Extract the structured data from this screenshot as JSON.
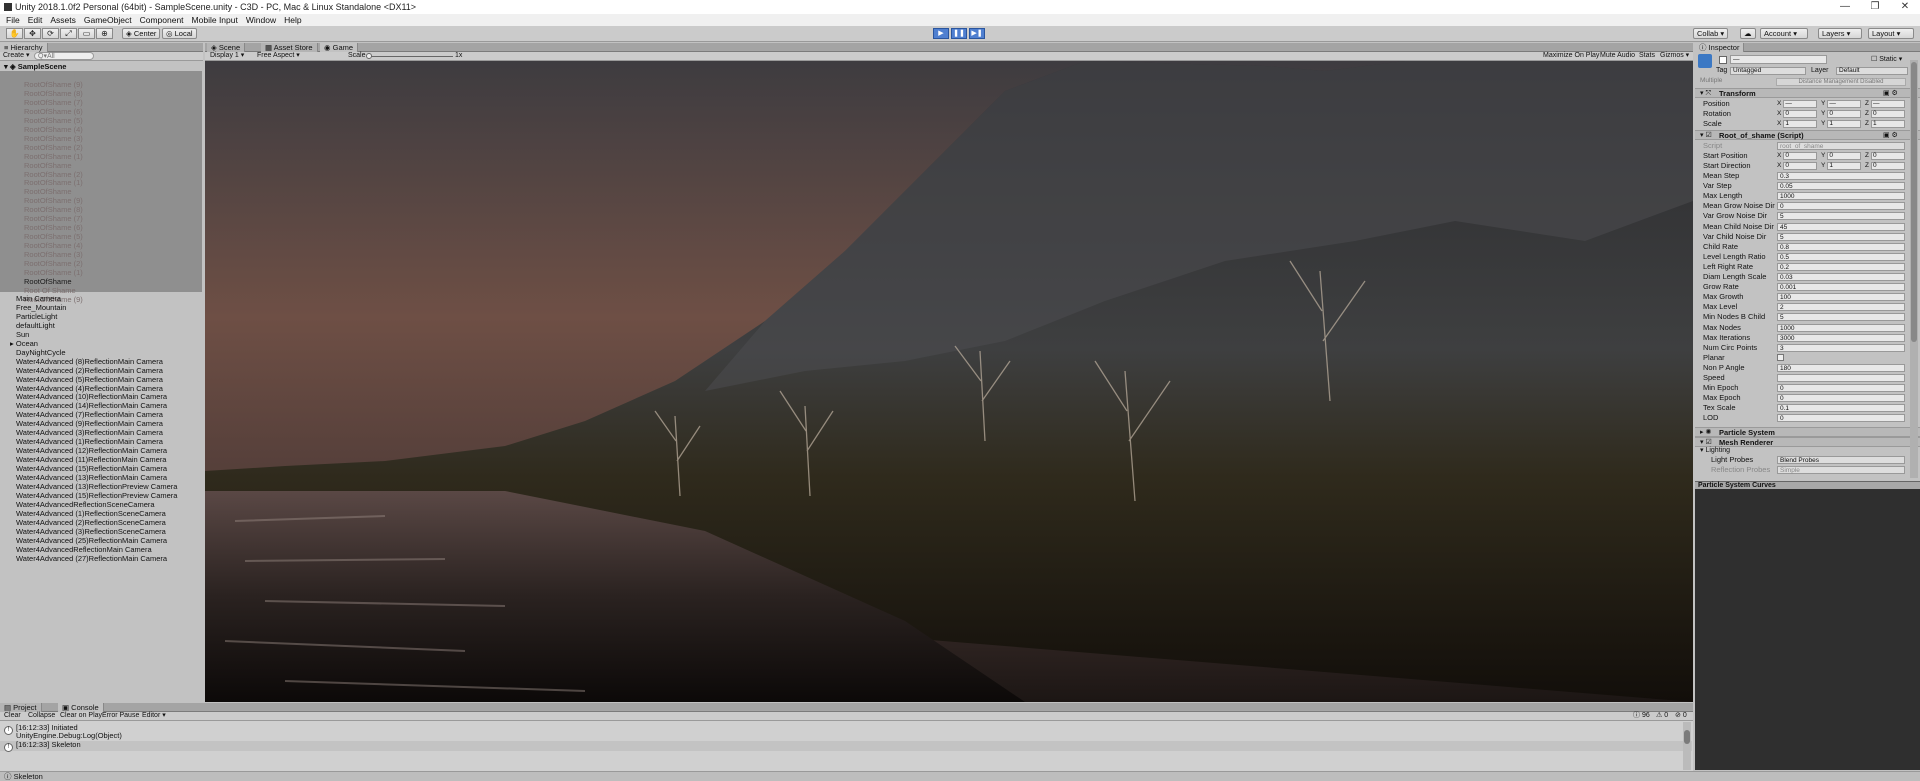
{
  "window": {
    "title": "Unity 2018.1.0f2 Personal (64bit) - SampleScene.unity - C3D - PC, Mac & Linux Standalone <DX11>",
    "controls": [
      "—",
      "❐",
      "✕"
    ]
  },
  "menu": [
    "File",
    "Edit",
    "Assets",
    "GameObject",
    "Component",
    "Mobile Input",
    "Window",
    "Help"
  ],
  "toolbar": {
    "pivot": "Center",
    "space": "Local",
    "collab": "Collab ▾",
    "account": "Account",
    "layers": "Layers",
    "layout": "Layout"
  },
  "hierarchy": {
    "tab": "Hierarchy",
    "create": "Create ▾",
    "search_placeholder": "Q▾All",
    "scene": "SampleScene",
    "group": "trees",
    "dim_items": [
      "RootOfShame (9)",
      "RootOfShame (8)",
      "RootOfShame (7)",
      "RootOfShame (6)",
      "RootOfShame (5)",
      "RootOfShame (4)",
      "RootOfShame (3)",
      "RootOfShame (2)",
      "RootOfShame (1)",
      "RootOfShame",
      "RootOfShame (2)",
      "RootOfShame (1)",
      "RootOfShame",
      "RootOfShame (9)",
      "RootOfShame (8)",
      "RootOfShame (7)",
      "RootOfShame (6)",
      "RootOfShame (5)",
      "RootOfShame (4)",
      "RootOfShame (3)",
      "RootOfShame (2)",
      "RootOfShame (1)"
    ],
    "highlight_item": "RootOfShame",
    "dim_tail": [
      "Root Of Shame",
      "RootOfShame (9)"
    ],
    "items": [
      "Main Camera",
      "Free_Mountain",
      "ParticleLight",
      "defaultLight",
      "Sun",
      "Ocean",
      "DayNightCycle",
      "Water4Advanced (8)ReflectionMain Camera",
      "Water4Advanced (2)ReflectionMain Camera",
      "Water4Advanced (5)ReflectionMain Camera",
      "Water4Advanced (4)ReflectionMain Camera",
      "Water4Advanced (10)ReflectionMain Camera",
      "Water4Advanced (14)ReflectionMain Camera",
      "Water4Advanced (7)ReflectionMain Camera",
      "Water4Advanced (9)ReflectionMain Camera",
      "Water4Advanced (3)ReflectionMain Camera",
      "Water4Advanced (1)ReflectionMain Camera",
      "Water4Advanced (12)ReflectionMain Camera",
      "Water4Advanced (11)ReflectionMain Camera",
      "Water4Advanced (15)ReflectionMain Camera",
      "Water4Advanced (13)ReflectionMain Camera",
      "Water4Advanced (13)ReflectionPreview Camera",
      "Water4Advanced (15)ReflectionPreview Camera",
      "Water4AdvancedReflectionSceneCamera",
      "Water4Advanced (1)ReflectionSceneCamera",
      "Water4Advanced (2)ReflectionSceneCamera",
      "Water4Advanced (3)ReflectionSceneCamera",
      "Water4Advanced (25)ReflectionMain Camera",
      "Water4AdvancedReflectionMain Camera",
      "Water4Advanced (27)ReflectionMain Camera"
    ]
  },
  "center": {
    "tabs": [
      "Scene",
      "Asset Store",
      "Game"
    ],
    "display": "Display 1",
    "aspect": "Free Aspect",
    "scale_label": "Scale",
    "scale_value": "1x",
    "options": [
      "Maximize On Play",
      "Mute Audio",
      "Stats",
      "Gizmos ▾"
    ]
  },
  "inspector": {
    "tab": "Inspector",
    "static_label": "Static",
    "tag_label": "Tag",
    "tag_value": "Untagged",
    "layer_label": "Layer",
    "layer_value": "Default",
    "multiple": "Multiple",
    "distance": "Distance Management Disabled",
    "transform": {
      "title": "Transform",
      "rows": [
        {
          "label": "Position",
          "x": "—",
          "y": "—",
          "z": "—"
        },
        {
          "label": "Rotation",
          "x": "0",
          "y": "0",
          "z": "0"
        },
        {
          "label": "Scale",
          "x": "1",
          "y": "1",
          "z": "1"
        }
      ]
    },
    "script_component": {
      "title": "Root_of_shame (Script)",
      "script_label": "Script",
      "script_value": "root_of_shame",
      "vectors": [
        {
          "label": "Start Position",
          "x": "0",
          "y": "0",
          "z": "0"
        },
        {
          "label": "Start Direction",
          "x": "0",
          "y": "1",
          "z": "0"
        }
      ],
      "fields": [
        {
          "label": "Mean Step",
          "value": "0.3"
        },
        {
          "label": "Var Step",
          "value": "0.05"
        },
        {
          "label": "Max Length",
          "value": "1000"
        },
        {
          "label": "Mean Grow Noise Dir",
          "value": "0"
        },
        {
          "label": "Var Grow Noise Dir",
          "value": "5"
        },
        {
          "label": "Mean Child Noise Dir",
          "value": "45"
        },
        {
          "label": "Var Child Noise Dir",
          "value": "5"
        },
        {
          "label": "Child Rate",
          "value": "0.8"
        },
        {
          "label": "Level Length Ratio",
          "value": "0.5"
        },
        {
          "label": "Left Right Rate",
          "value": "0.2"
        },
        {
          "label": "Diam Length Scale",
          "value": "0.03"
        },
        {
          "label": "Grow Rate",
          "value": "0.001"
        },
        {
          "label": "Max Growth",
          "value": "100"
        },
        {
          "label": "Max Level",
          "value": "2"
        },
        {
          "label": "Min Nodes B Child",
          "value": "5"
        },
        {
          "label": "Max Nodes",
          "value": "1000"
        },
        {
          "label": "Max Iterations",
          "value": "3000"
        },
        {
          "label": "Num Circ Points",
          "value": "3"
        },
        {
          "label": "Planar",
          "value": ""
        },
        {
          "label": "Non P Angle",
          "value": "180"
        },
        {
          "label": "Speed",
          "value": ""
        },
        {
          "label": "Min Epoch",
          "value": "0"
        },
        {
          "label": "Max Epoch",
          "value": "0"
        },
        {
          "label": "Tex Scale",
          "value": "0.1"
        },
        {
          "label": "LOD",
          "value": "0"
        }
      ]
    },
    "particle_system": "Particle System",
    "mesh_renderer": "Mesh Renderer",
    "lighting": "Lighting",
    "light_probes_label": "Light Probes",
    "light_probes_value": "Blend Probes",
    "reflection_label": "Reflection Probes",
    "reflection_value": "Simple",
    "curves_title": "Particle System Curves"
  },
  "bottom": {
    "tabs": [
      "Project",
      "Console"
    ],
    "buttons": [
      "Clear",
      "Collapse",
      "Clear on Play",
      "Error Pause",
      "Editor ▾"
    ],
    "counts": [
      "96",
      "0",
      "0"
    ],
    "logs": [
      {
        "line1": "[16:12:33] Initiated",
        "line2": "UnityEngine.Debug:Log(Object)"
      },
      {
        "line1": "[16:12:33] Skeleton",
        "line2": ""
      }
    ]
  },
  "status": "Skeleton"
}
